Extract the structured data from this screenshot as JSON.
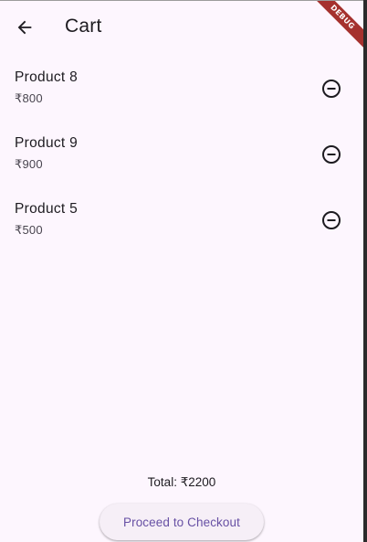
{
  "appbar": {
    "title": "Cart",
    "back_icon": "arrow-back-icon"
  },
  "debug_banner": "DEBUG",
  "cart": {
    "items": [
      {
        "name": "Product 8",
        "price": "₹800"
      },
      {
        "name": "Product 9",
        "price": "₹900"
      },
      {
        "name": "Product 5",
        "price": "₹500"
      }
    ],
    "remove_icon": "remove-circle-outline-icon"
  },
  "footer": {
    "total_label": "Total: ₹2200",
    "checkout_label": "Proceed to Checkout"
  },
  "colors": {
    "background": "#fdf6fe",
    "accent": "#6750a4",
    "ribbon": "#a5312e"
  }
}
